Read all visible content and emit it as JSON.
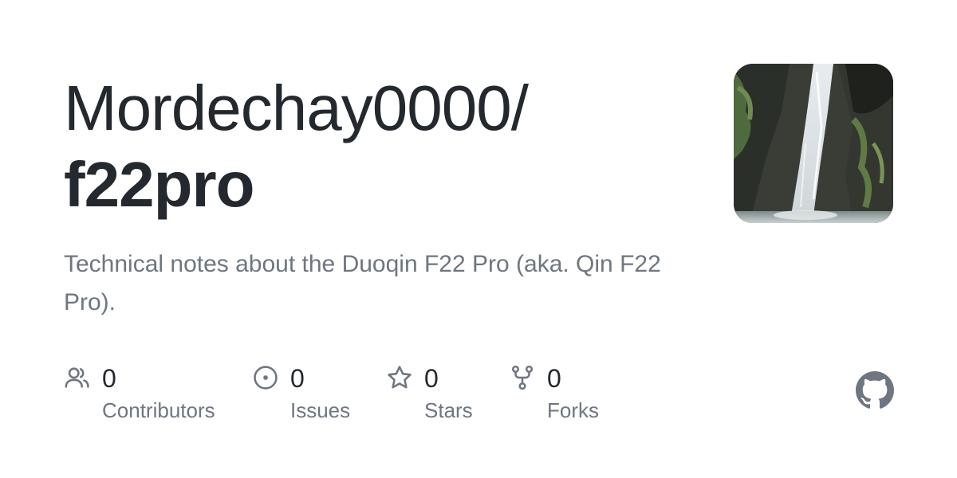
{
  "repo": {
    "owner": "Mordechay0000/",
    "name": "f22pro",
    "description": "Technical notes about the Duoqin F22 Pro (aka. Qin F22 Pro)."
  },
  "stats": [
    {
      "key": "contributors",
      "count": "0",
      "label": "Contributors",
      "icon": "people-icon"
    },
    {
      "key": "issues",
      "count": "0",
      "label": "Issues",
      "icon": "issue-opened-icon"
    },
    {
      "key": "stars",
      "count": "0",
      "label": "Stars",
      "icon": "star-icon"
    },
    {
      "key": "forks",
      "count": "0",
      "label": "Forks",
      "icon": "repo-forked-icon"
    }
  ],
  "colors": {
    "text_primary": "#24292f",
    "text_muted": "#6e7681",
    "icon_gray": "#6e7681"
  }
}
